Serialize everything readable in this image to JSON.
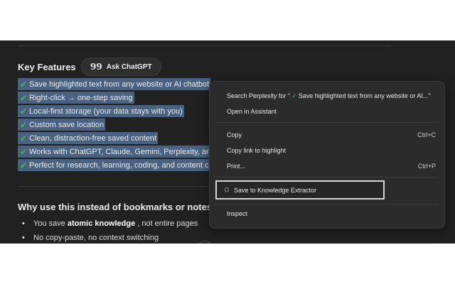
{
  "content": {
    "section_title": "Key Features",
    "ask_button": {
      "icon": "quote-icon",
      "glyph": "99",
      "label": "Ask ChatGPT"
    },
    "features": [
      "Save highlighted text from any website or AI chatbot",
      "Right-click → one-step saving",
      "Local-first storage (your data stays with you)",
      "Custom save location",
      "Clean, distraction-free saved content",
      "Works with ChatGPT, Claude, Gemini, Perplexity, and",
      "Perfect for research, learning, coding, and content cr"
    ],
    "why_title": "Why use this instead of bookmarks or notes app",
    "why_items": [
      {
        "pre": "You save",
        "bold": "atomic knowledge",
        "post": ", not entire pages"
      },
      {
        "pre": "No copy-paste, no context switching",
        "bold": "",
        "post": ""
      }
    ]
  },
  "context_menu": {
    "search": {
      "prefix": "Search Perplexity for \"",
      "check": "✓",
      "query": "Save highlighted text from any website or AI...\""
    },
    "open_assistant": "Open in Assistant",
    "copy": {
      "label": "Copy",
      "shortcut": "Ctrl+C"
    },
    "copy_link": "Copy link to highlight",
    "print": {
      "label": "Print...",
      "shortcut": "Ctrl+P"
    },
    "save_extractor": "Save to Knowledge Extractor",
    "inspect": "Inspect"
  },
  "colors": {
    "background": "#212121",
    "selection": "#4a6282",
    "check": "#3fb950",
    "menu": "#2b2b2b"
  }
}
